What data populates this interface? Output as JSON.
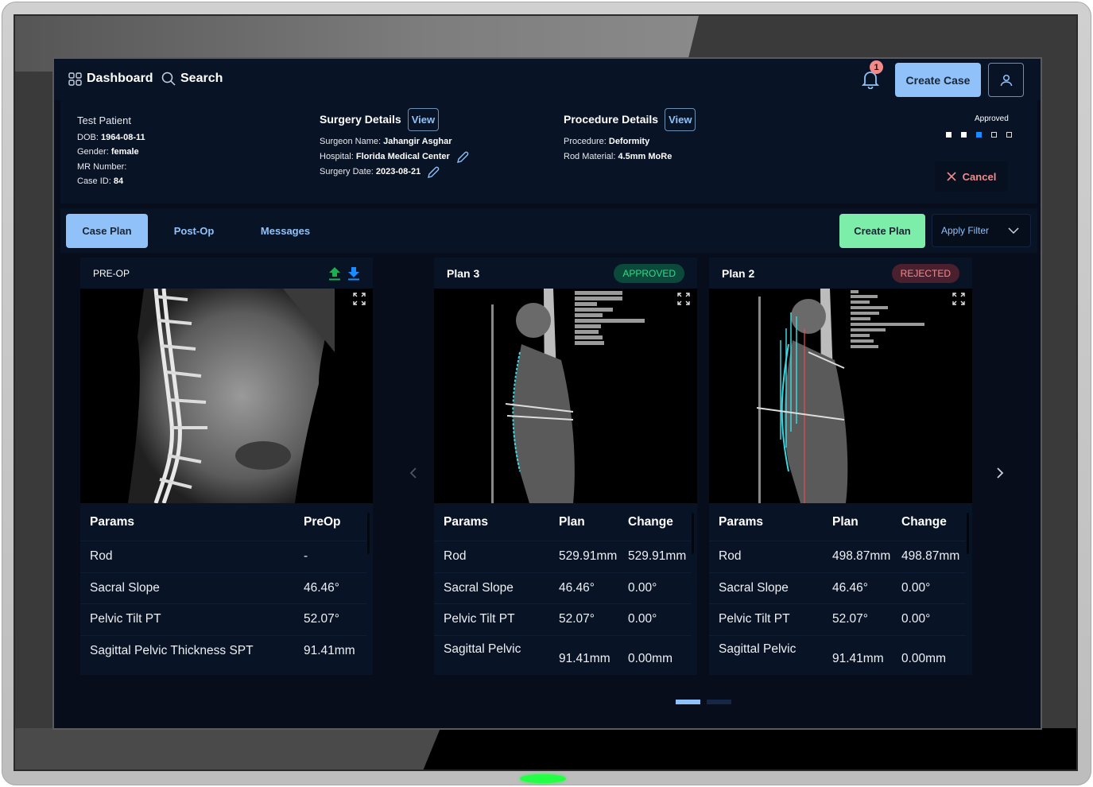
{
  "header": {
    "nav": [
      {
        "label": "Dashboard",
        "icon": "grid-icon"
      },
      {
        "label": "Search",
        "icon": "search-icon"
      }
    ],
    "notification_count": "1",
    "create_case_label": "Create Case",
    "user_icon": "user-icon"
  },
  "patient": {
    "name": "Test Patient",
    "fields": [
      {
        "label": "DOB: ",
        "value": "1964-08-11"
      },
      {
        "label": "Gender: ",
        "value": "female"
      },
      {
        "label": "MR Number: ",
        "value": ""
      },
      {
        "label": "Case ID: ",
        "value": "84"
      }
    ]
  },
  "surgery_details": {
    "title": "Surgery Details",
    "view_label": "View",
    "fields": [
      {
        "label": "Surgeon Name: ",
        "value": "Jahangir Asghar",
        "editable": false
      },
      {
        "label": "Hospital: ",
        "value": "Florida Medical Center",
        "editable": true
      },
      {
        "label": "Surgery Date: ",
        "value": "2023-08-21",
        "editable": true
      }
    ]
  },
  "procedure_details": {
    "title": "Procedure Details",
    "view_label": "View",
    "fields": [
      {
        "label": "Procedure: ",
        "value": "Deformity"
      },
      {
        "label": "Rod Material: ",
        "value": "4.5mm MoRe"
      }
    ]
  },
  "status": {
    "label": "Approved",
    "steps": [
      "done",
      "done",
      "current",
      "todo",
      "todo"
    ],
    "cancel_label": "Cancel"
  },
  "tabs": [
    {
      "label": "Case Plan",
      "active": true
    },
    {
      "label": "Post-Op",
      "active": false
    },
    {
      "label": "Messages",
      "active": false
    }
  ],
  "toolbar": {
    "create_plan_label": "Create Plan",
    "filter_label": "Apply Filter"
  },
  "cards": [
    {
      "title": "PRE-OP",
      "badge": null,
      "columns": [
        "Params",
        "PreOp"
      ],
      "rows": [
        [
          "Rod",
          "-"
        ],
        [
          "Sacral Slope",
          "46.46°"
        ],
        [
          "Pelvic Tilt PT",
          "52.07°"
        ],
        [
          "Sagittal Pelvic Thickness SPT",
          "91.41mm"
        ]
      ]
    },
    {
      "title": "Plan 3",
      "badge": "APPROVED",
      "columns": [
        "Params",
        "Plan",
        "Change"
      ],
      "rows": [
        [
          "Rod",
          "529.91mm",
          "529.91mm"
        ],
        [
          "Sacral Slope",
          "46.46°",
          "0.00°"
        ],
        [
          "Pelvic Tilt PT",
          "52.07°",
          "0.00°"
        ],
        [
          "Sagittal Pelvic",
          "91.41mm",
          "0.00mm"
        ]
      ]
    },
    {
      "title": "Plan 2",
      "badge": "REJECTED",
      "columns": [
        "Params",
        "Plan",
        "Change"
      ],
      "rows": [
        [
          "Rod",
          "498.87mm",
          "498.87mm"
        ],
        [
          "Sacral Slope",
          "46.46°",
          "0.00°"
        ],
        [
          "Pelvic Tilt PT",
          "52.07°",
          "0.00°"
        ],
        [
          "Sagittal Pelvic",
          "91.41mm",
          "0.00mm"
        ]
      ]
    }
  ],
  "carousel": {
    "pages": 2,
    "current": 1
  },
  "colors": {
    "accent": "#90c2f9",
    "success": "#7deeaa",
    "danger": "#f38b8b",
    "background": "#070d1a",
    "panel": "#081326"
  }
}
